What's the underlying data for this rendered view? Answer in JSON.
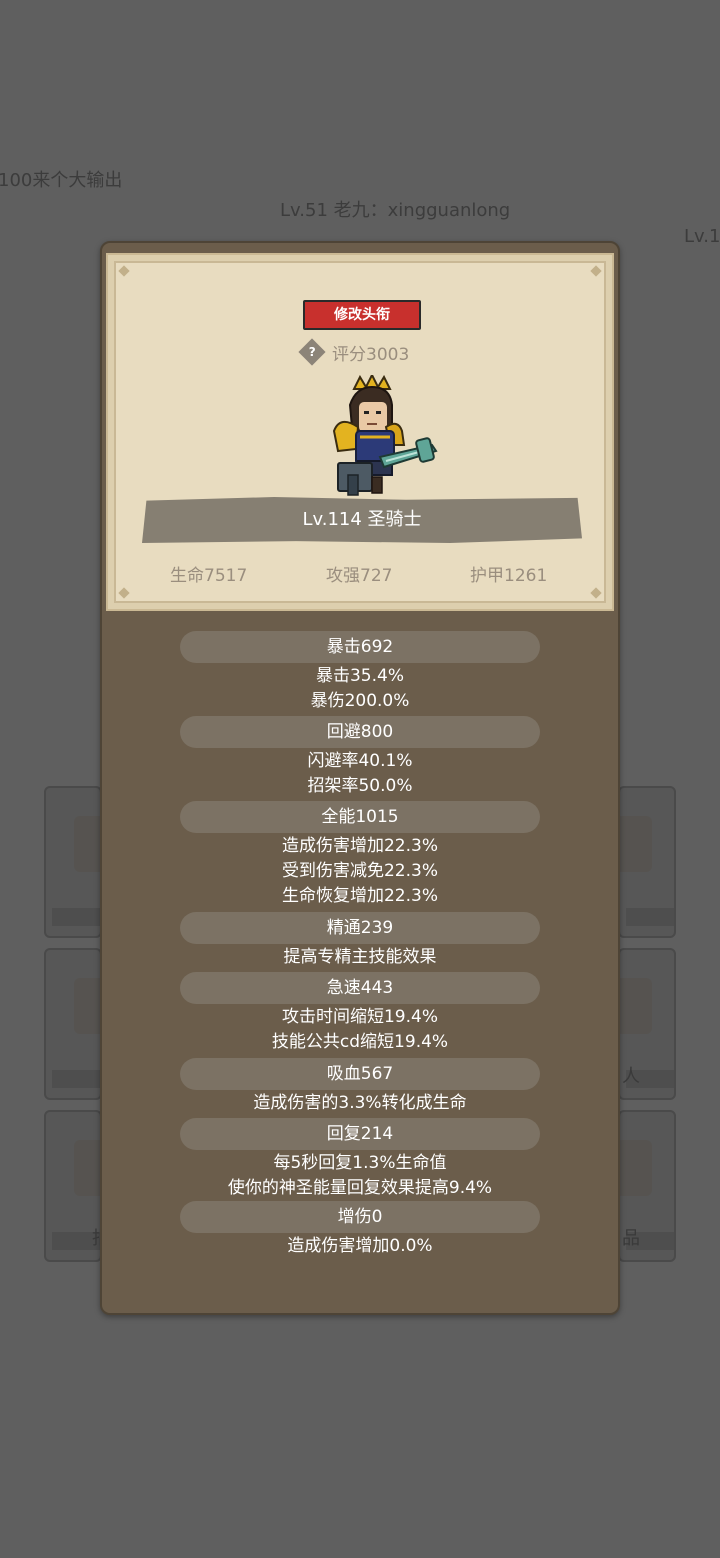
{
  "background": {
    "chat_text": "100来个大输出",
    "player_line": "Lv.51 老九：xingguanlong",
    "player_line_right": "Lv.1",
    "right_caption_1": "人",
    "left_caption_2": "指",
    "right_caption_2": "品"
  },
  "profile": {
    "edit_title_label": "修改头衔",
    "score": "评分3003",
    "help_icon": "?",
    "name": "Lv.114 圣骑士",
    "hp": "生命7517",
    "attack": "攻强727",
    "armor": "护甲1261"
  },
  "stats": [
    {
      "header": "暴击692",
      "lines": [
        "暴击35.4%",
        "暴伤200.0%"
      ]
    },
    {
      "header": "回避800",
      "lines": [
        "闪避率40.1%",
        "招架率50.0%"
      ]
    },
    {
      "header": "全能1015",
      "lines": [
        "造成伤害增加22.3%",
        "受到伤害减免22.3%",
        "生命恢复增加22.3%"
      ]
    },
    {
      "header": "精通239",
      "lines": [
        "提高专精主技能效果"
      ]
    },
    {
      "header": "急速443",
      "lines": [
        "攻击时间缩短19.4%",
        "技能公共cd缩短19.4%"
      ]
    },
    {
      "header": "吸血567",
      "lines": [
        "造成伤害的3.3%转化成生命"
      ]
    },
    {
      "header": "回复214",
      "lines": [
        "每5秒回复1.3%生命值",
        "使你的神圣能量回复效果提高9.4%"
      ]
    },
    {
      "header": "增伤0",
      "lines": [
        "造成伤害增加0.0%"
      ]
    }
  ],
  "colors": {
    "title_button": "#c8302d",
    "panel": "#6b5d4b",
    "header_bg": "#e8dcc0",
    "stat_pill": "#7c7264"
  }
}
